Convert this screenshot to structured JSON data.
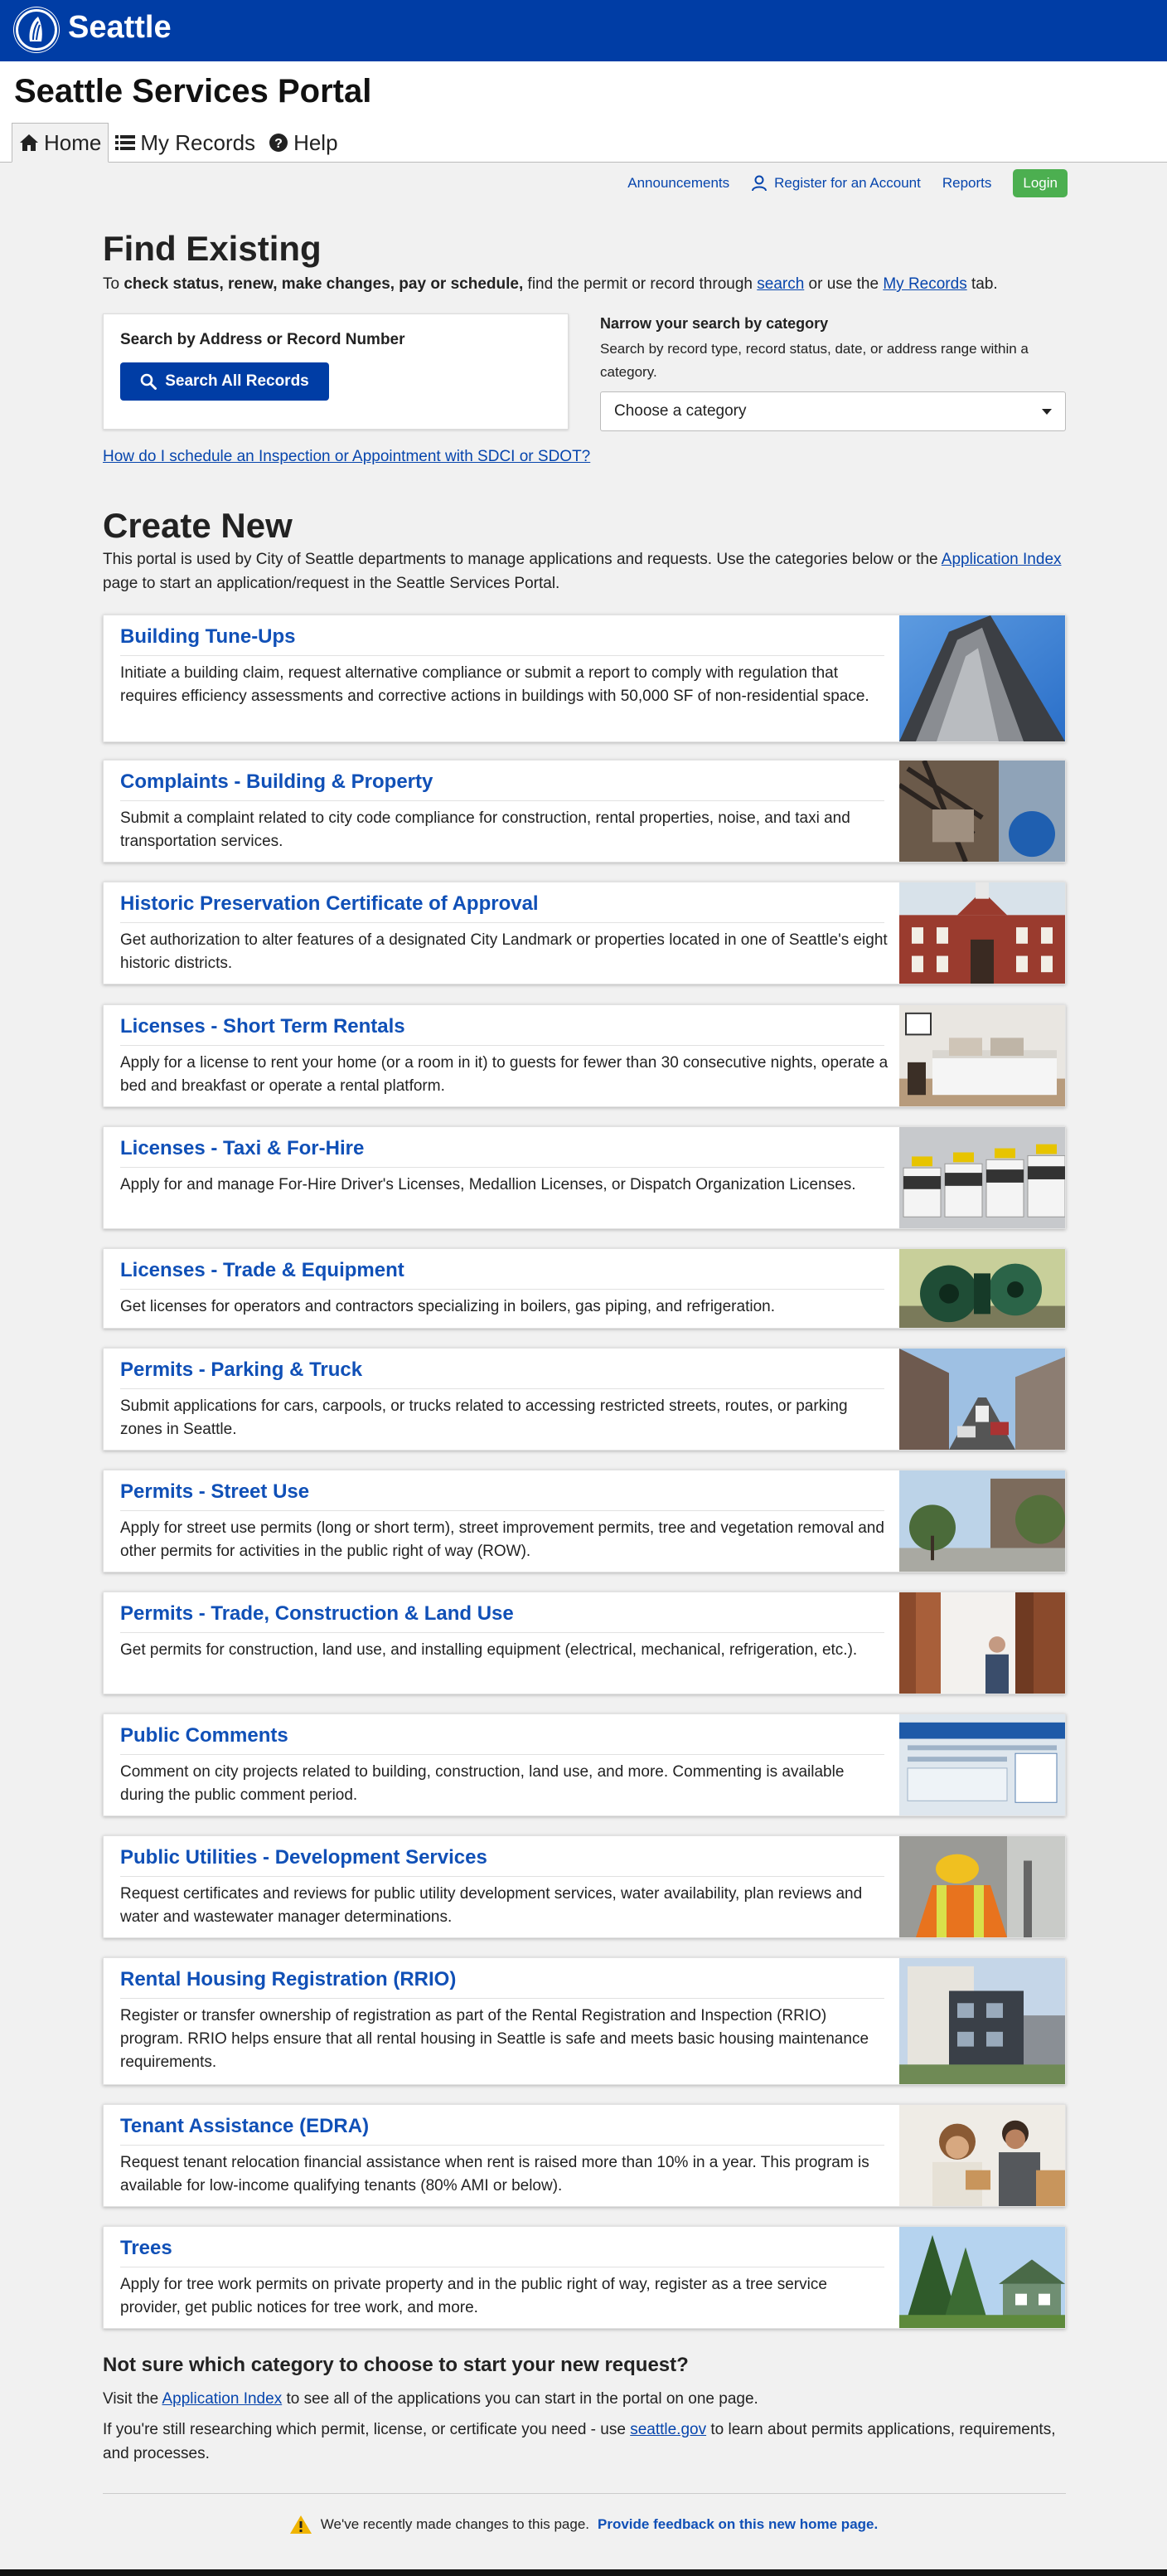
{
  "site": {
    "brand": "Seattle"
  },
  "header": {
    "portal_title": "Seattle Services Portal"
  },
  "tabs": [
    {
      "label": "Home",
      "icon": "home-icon"
    },
    {
      "label": "My Records",
      "icon": "list-icon"
    },
    {
      "label": "Help",
      "icon": "help-icon"
    }
  ],
  "utility_nav": {
    "announcements": "Announcements",
    "register": "Register for an Account",
    "reports": "Reports",
    "login": "Login"
  },
  "find_existing": {
    "title": "Find Existing",
    "lead_pre": "To ",
    "lead_bold": "check status, renew, make changes, pay or schedule,",
    "lead_mid": " find the permit or record through ",
    "lead_search_link": "search",
    "lead_mid2": " or use the ",
    "lead_records_link": "My Records",
    "lead_end": " tab.",
    "search_label": "Search by Address or Record Number",
    "search_button": "Search All Records",
    "narrow_title": "Narrow your search by category",
    "narrow_desc": "Search by record type, record status, date, or address range within a category.",
    "category_placeholder": "Choose a category",
    "inspection_link": "How do I schedule an Inspection or Appointment with SDCI or SDOT?"
  },
  "create_new": {
    "title": "Create New",
    "lead_pre": "This portal is used by City of Seattle departments to manage applications and requests. Use the categories below or the ",
    "lead_link": "Application Index",
    "lead_end": " page to start an application/request in the Seattle Services Portal.",
    "cards": [
      {
        "title": "Building Tune-Ups",
        "desc": "Initiate a building claim, request alternative compliance or submit a report to comply with regulation that requires efficiency assessments and corrective actions in buildings with 50,000 SF of non-residential space."
      },
      {
        "title": "Complaints - Building & Property",
        "desc": "Submit a complaint related to city code compliance for construction, rental properties, noise, and taxi and transportation services."
      },
      {
        "title": "Historic Preservation Certificate of Approval",
        "desc": "Get authorization to alter features of a designated City Landmark or properties located in one of Seattle's eight historic districts."
      },
      {
        "title": "Licenses - Short Term Rentals",
        "desc": "Apply for a license to rent your home (or a room in it) to guests for fewer than 30 consecutive nights, operate a bed and breakfast or operate a rental platform."
      },
      {
        "title": "Licenses - Taxi & For-Hire",
        "desc": "Apply for and manage For-Hire Driver's Licenses, Medallion Licenses, or Dispatch Organization Licenses."
      },
      {
        "title": "Licenses - Trade & Equipment",
        "desc": "Get licenses for operators and contractors specializing in boilers, gas piping, and refrigeration."
      },
      {
        "title": "Permits - Parking & Truck",
        "desc": "Submit applications for cars, carpools, or trucks related to accessing restricted streets, routes, or parking zones in Seattle."
      },
      {
        "title": "Permits - Street Use",
        "desc": "Apply for street use permits (long or short term), street improvement permits, tree and vegetation removal and other permits for activities in the public right of way (ROW)."
      },
      {
        "title": "Permits - Trade, Construction & Land Use",
        "desc": "Get permits for construction, land use, and installing equipment (electrical, mechanical, refrigeration, etc.)."
      },
      {
        "title": "Public Comments",
        "desc": "Comment on city projects related to building, construction, land use, and more. Commenting is available during the public comment period."
      },
      {
        "title": "Public Utilities - Development Services",
        "desc": "Request certificates and reviews for public utility development services, water availability, plan reviews and water and wastewater manager determinations."
      },
      {
        "title": "Rental Housing Registration (RRIO)",
        "desc": "Register or transfer ownership of registration as part of the Rental Registration and Inspection (RRIO) program. RRIO helps ensure that all rental housing in Seattle is safe and meets basic housing maintenance requirements."
      },
      {
        "title": "Tenant Assistance (EDRA)",
        "desc": "Request tenant relocation financial assistance when rent is raised more than 10% in a year. This program is available for low-income qualifying tenants (80% AMI or below)."
      },
      {
        "title": "Trees",
        "desc": "Apply for tree work permits on private property and in the public right of way, register as a tree service provider, get public notices for tree work, and more."
      }
    ]
  },
  "not_sure": {
    "title": "Not sure which category to choose to start your new request?",
    "line1_pre": "Visit the ",
    "line1_link": "Application Index",
    "line1_end": " to see all of the applications you can start in the portal on one page.",
    "line2_pre": "If you're still researching which permit, license, or certificate you need - use ",
    "line2_link": "seattle.gov",
    "line2_end": " to learn about permits applications, requirements, and processes."
  },
  "footer": {
    "notice": "We've recently made changes to this page.",
    "feedback_link": "Provide feedback on this new home page."
  }
}
